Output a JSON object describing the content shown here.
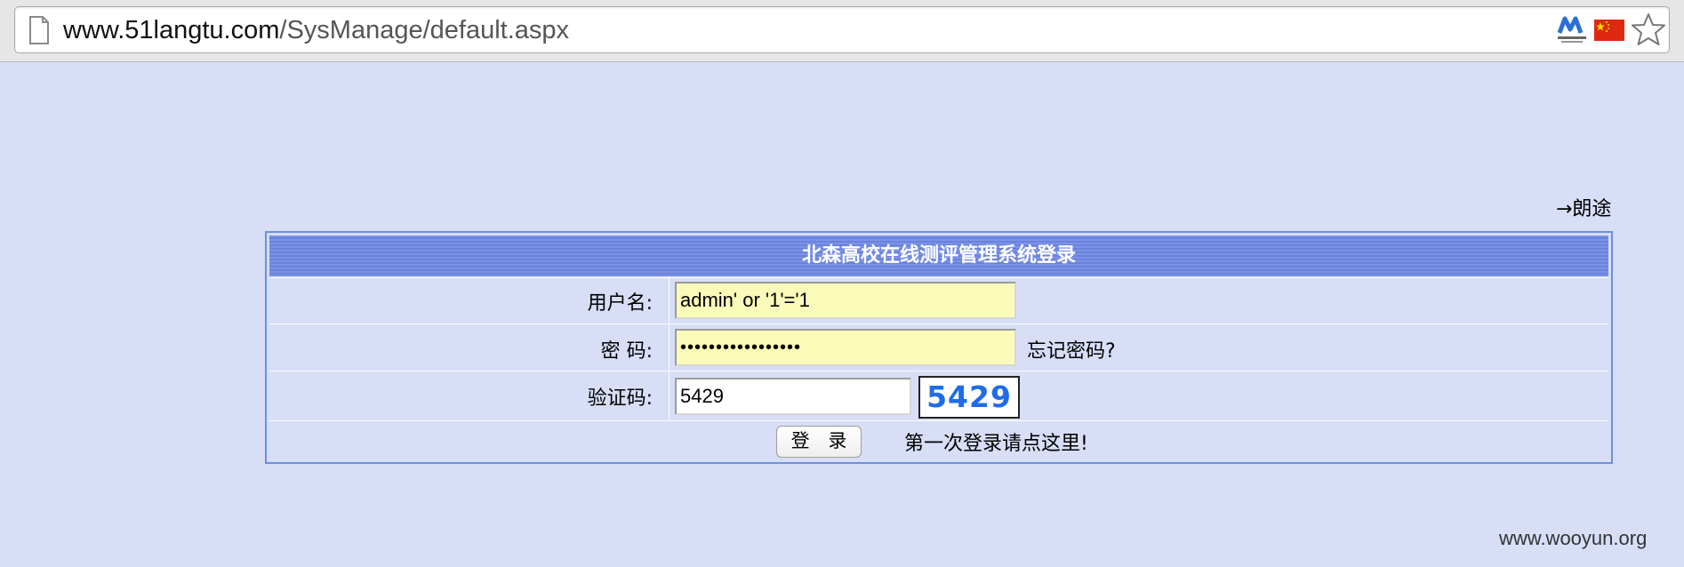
{
  "browser": {
    "url_host": "www.51langtu.com",
    "url_path": "/SysManage/default.aspx",
    "page_icon": "page-icon",
    "extension_icons": [
      "net-extension-icon",
      "china-flag-icon"
    ],
    "bookmark_icon": "star-icon"
  },
  "marquee_text": "→朗途",
  "login": {
    "title": "北森高校在线测评管理系统登录",
    "username_label": "用户名:",
    "username_value": "admin' or '1'='1",
    "password_label": "密 码:",
    "password_value": "•••••••••••••••••",
    "forgot_password": "忘记密码?",
    "captcha_label": "验证码:",
    "captcha_value": "5429",
    "captcha_image_text": "5429",
    "login_button": "登 录",
    "first_login": "第一次登录请点这里!"
  },
  "watermark": "www.wooyun.org",
  "colors": {
    "page_bg": "#d7def6",
    "title_bar": "#7389e0",
    "input_highlight": "#fafbb9",
    "captcha_text": "#1f6ce8"
  }
}
